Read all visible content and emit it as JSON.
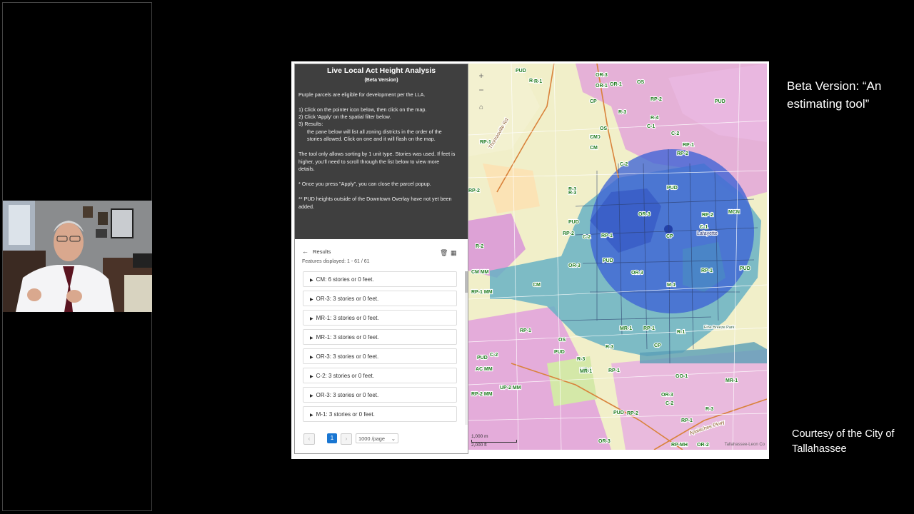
{
  "slide": {
    "caption_beta": "Beta Version: “An estimating tool”",
    "caption_courtesy": "Courtesy of the City of Tallahassee"
  },
  "panel": {
    "title": "Live Local Act Height Analysis",
    "subtitle": "(Beta Version)",
    "instructions": [
      "Purple parcels are eligible for development per the LLA.",
      "1) Click on the pointer icon below, then click on the map.",
      "2) Click 'Apply' on the spatial filter below.",
      "3) Results:",
      "the pane below will list all zoning districts in the order of the",
      "stories allowed. Click on one and it will flash on the map.",
      "The tool only allows sorting by 1 unit type. Stories was used. If feet is",
      "higher, you'll need to scroll through the list below to view more",
      "details.",
      "* Once you press \"Apply\", you can close the parcel popup.",
      "** PUD heights outside of the Downtown Overlay have not yet been",
      "added."
    ],
    "results_label": "Results",
    "features_displayed": "Features displayed: 1 - 61 / 61",
    "results": [
      "CM: 6 stories or 0 feet.",
      "OR-3: 3 stories or 0 feet.",
      "MR-1: 3 stories or 0 feet.",
      "MR-1: 3 stories or 0 feet.",
      "OR-3: 3 stories or 0 feet.",
      "C-2: 3 stories or 0 feet.",
      "OR-3: 3 stories or 0 feet.",
      "M-1: 3 stories or 0 feet."
    ],
    "pager": {
      "current": "1",
      "page_size": "1000  /page"
    }
  },
  "map": {
    "scale_top": "1,000 m",
    "scale_bottom": "2,000 ft",
    "attribution": "Tallahassee-Leon Co",
    "labels": [
      "PUD",
      "OR-3",
      "OR-1",
      "R-1",
      "OS",
      "CP",
      "R-3",
      "PUD",
      "RP-2",
      "R-4",
      "C-1",
      "C-2",
      "CM",
      "RP-1",
      "PUD",
      "OS",
      "C-2",
      "RP-2",
      "R-3",
      "PUD",
      "OR-3",
      "CP",
      "RP-2",
      "MCN",
      "C-1",
      "RP-1",
      "M-1",
      "RP-1",
      "PUD",
      "MR-1",
      "RP-1",
      "R-1",
      "OS",
      "PUD",
      "R-3",
      "GO-1",
      "MR-1",
      "RP-1",
      "OR-3",
      "C-2",
      "RP-2",
      "PUD",
      "RP-1",
      "R-3",
      "RP-MH",
      "OR-2",
      "OR-3",
      "MR-1",
      "RP-1",
      "C-2",
      "PUD",
      "CM MM",
      "RP-1 MM",
      "RP-2 MM",
      "UP-2 MM",
      "AC MM",
      "CM",
      "R-3",
      "OR-3",
      "C-2",
      "RP-2",
      "PUD",
      "MR-1",
      "R-1",
      "RP-1",
      "CP",
      "OR-3",
      "R-3",
      "OR-1",
      "RP-2",
      "PUD",
      "R-2",
      "CM"
    ],
    "road_labels": [
      "Thomasville Rd",
      "Apalachee Pkwy"
    ],
    "place_label": "Lafayette",
    "park_label": "Fine Breeze Park"
  }
}
